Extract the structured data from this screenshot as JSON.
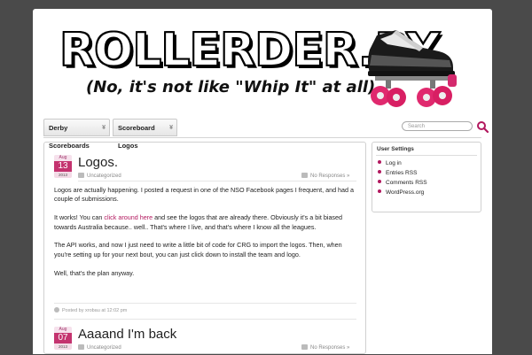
{
  "header": {
    "logo_text": "ROLLERDER.BY",
    "tagline": "(No, it's not like \"Whip It\" at all)"
  },
  "nav": {
    "tabs": [
      {
        "label": "Derby Scoreboards"
      },
      {
        "label": "Scoreboard Logos"
      }
    ],
    "search_placeholder": "Search"
  },
  "posts": [
    {
      "date": {
        "month": "Aug",
        "day": "13",
        "year": "2013"
      },
      "title": "Logos.",
      "category": "Uncategorized",
      "responses": "No Responses »",
      "paragraphs": [
        {
          "text": "Logos are actually happening. I posted a request in one of the NSO Facebook pages I frequent, and had a couple of submissions."
        },
        {
          "before": "It works!  You can ",
          "link": "click around here",
          "after": " and see the logos that are already there. Obviously it's a bit biased towards Australia because.. well.. That's where I live, and that's where I know all the leagues."
        },
        {
          "text": "The API works, and now I just need to write a little bit of code for CRG to import the logos.  Then, when you're setting up for your next bout, you can just click down to install the team and logo."
        },
        {
          "text": "Well, that's the plan anyway."
        }
      ],
      "posted_by": "Posted by xrobau at 12:02 pm"
    },
    {
      "date": {
        "month": "Aug",
        "day": "07",
        "year": "2013"
      },
      "title": "Aaaand I'm back",
      "category": "Uncategorized",
      "responses": "No Responses »"
    }
  ],
  "sidebar": {
    "title": "User Settings",
    "items": [
      "Log in",
      "Entries RSS",
      "Comments RSS",
      "WordPress.org"
    ]
  },
  "colors": {
    "accent": "#c4336f",
    "link": "#b2185e",
    "background": "#4a4a4a"
  }
}
